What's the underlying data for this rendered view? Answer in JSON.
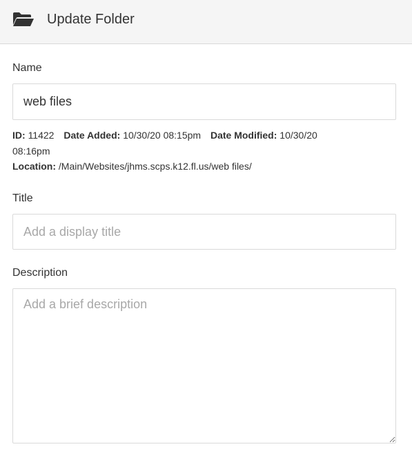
{
  "header": {
    "icon": "folder-open-icon",
    "title": "Update Folder"
  },
  "form": {
    "name": {
      "label": "Name",
      "value": "web files"
    },
    "meta": {
      "id_label": "ID:",
      "id_value": "11422",
      "date_added_label": "Date Added:",
      "date_added_value": "10/30/20 08:15pm",
      "date_modified_label": "Date Modified:",
      "date_modified_value_line1": "10/30/20",
      "date_modified_value_line2": "08:16pm",
      "location_label": "Location:",
      "location_value": "/Main/Websites/jhms.scps.k12.fl.us/web files/"
    },
    "title": {
      "label": "Title",
      "value": "",
      "placeholder": "Add a display title"
    },
    "description": {
      "label": "Description",
      "value": "",
      "placeholder": "Add a brief description"
    }
  }
}
